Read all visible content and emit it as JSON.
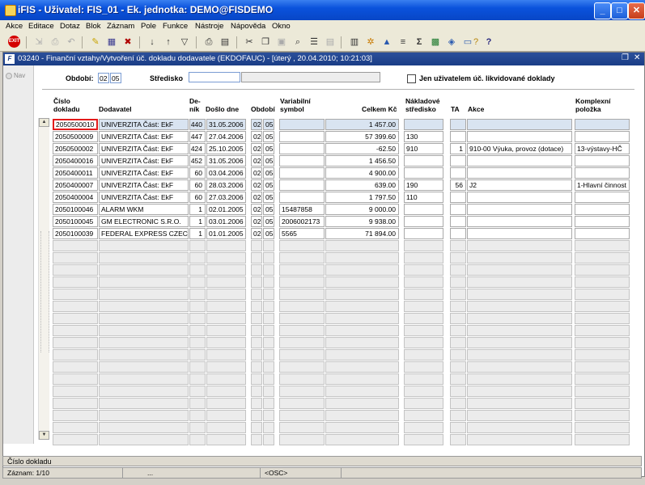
{
  "window": {
    "title": "iFIS - Uživatel: FIS_01 - Ek. jednotka: DEMO@FISDEMO"
  },
  "menu": [
    "Akce",
    "Editace",
    "Dotaz",
    "Blok",
    "Záznam",
    "Pole",
    "Funkce",
    "Nástroje",
    "Nápověda",
    "Okno"
  ],
  "toolbar": {
    "exit_label": "EXIT"
  },
  "form": {
    "title": "03240 - Finanční vztahy/Vytvoření úč. dokladu dodavatele (EKDOFAUC) - [úterý , 20.04.2010; 10:21:03]",
    "nav_label": "Nav",
    "obdobi_label": "Období:",
    "obdobi_1": "02",
    "obdobi_2": "05",
    "stredisko_label": "Středisko",
    "stredisko_value": "",
    "stredisko_desc": "",
    "only_user_label": "Jen uživatelem úč. likvidované doklady"
  },
  "columns": {
    "cislo": [
      "Číslo",
      "dokladu"
    ],
    "dodavatel": "Dodavatel",
    "denik": [
      "De-",
      "ník"
    ],
    "doslo": "Došlo dne",
    "obdobi": "Období",
    "vs": [
      "Variabilní",
      "symbol"
    ],
    "celkem": "Celkem Kč",
    "nakl": [
      "Nákladové",
      "středisko"
    ],
    "ta": "TA",
    "akce": "Akce",
    "komplex": [
      "Komplexní",
      "položka"
    ]
  },
  "rows": [
    {
      "cislo": "2050500010",
      "dodavatel": "UNIVERZITA Část: EkF",
      "denik": "440",
      "doslo": "31.05.2006",
      "o1": "02",
      "o2": "05",
      "vs": "",
      "celkem": "1 457.00",
      "nakl": "",
      "ta": "",
      "akce": "",
      "komplex": ""
    },
    {
      "cislo": "2050500009",
      "dodavatel": "UNIVERZITA Část: EkF",
      "denik": "447",
      "doslo": "27.04.2006",
      "o1": "02",
      "o2": "05",
      "vs": "",
      "celkem": "57 399.60",
      "nakl": "130",
      "ta": "",
      "akce": "",
      "komplex": ""
    },
    {
      "cislo": "2050500002",
      "dodavatel": "UNIVERZITA Část: EkF",
      "denik": "424",
      "doslo": "25.10.2005",
      "o1": "02",
      "o2": "05",
      "vs": "",
      "celkem": "-62.50",
      "nakl": "910",
      "ta": "1",
      "akce": "910-00 Výuka, provoz (dotace)",
      "komplex": "13-výstavy-HČ"
    },
    {
      "cislo": "2050400016",
      "dodavatel": "UNIVERZITA Část: EkF",
      "denik": "452",
      "doslo": "31.05.2006",
      "o1": "02",
      "o2": "05",
      "vs": "",
      "celkem": "1 456.50",
      "nakl": "",
      "ta": "",
      "akce": "",
      "komplex": ""
    },
    {
      "cislo": "2050400011",
      "dodavatel": "UNIVERZITA Část: EkF",
      "denik": "60",
      "doslo": "03.04.2006",
      "o1": "02",
      "o2": "05",
      "vs": "",
      "celkem": "4 900.00",
      "nakl": "",
      "ta": "",
      "akce": "",
      "komplex": ""
    },
    {
      "cislo": "2050400007",
      "dodavatel": "UNIVERZITA Část: EkF",
      "denik": "60",
      "doslo": "28.03.2006",
      "o1": "02",
      "o2": "05",
      "vs": "",
      "celkem": "639.00",
      "nakl": "190",
      "ta": "56",
      "akce": "J2",
      "komplex": "1-Hlavní činnost"
    },
    {
      "cislo": "2050400004",
      "dodavatel": "UNIVERZITA Část: EkF",
      "denik": "60",
      "doslo": "27.03.2006",
      "o1": "02",
      "o2": "05",
      "vs": "",
      "celkem": "1 797.50",
      "nakl": "110",
      "ta": "",
      "akce": "",
      "komplex": ""
    },
    {
      "cislo": "2050100046",
      "dodavatel": "ALARM WKM",
      "denik": "1",
      "doslo": "02.01.2005",
      "o1": "02",
      "o2": "05",
      "vs": "15487858",
      "celkem": "9 000.00",
      "nakl": "",
      "ta": "",
      "akce": "",
      "komplex": ""
    },
    {
      "cislo": "2050100045",
      "dodavatel": "GM ELECTRONIC S.R.O.",
      "denik": "1",
      "doslo": "03.01.2006",
      "o1": "02",
      "o2": "05",
      "vs": "2006002173",
      "celkem": "9 938.00",
      "nakl": "",
      "ta": "",
      "akce": "",
      "komplex": ""
    },
    {
      "cislo": "2050100039",
      "dodavatel": "FEDERAL EXPRESS CZEC",
      "denik": "1",
      "doslo": "01.01.2005",
      "o1": "02",
      "o2": "05",
      "vs": "5565",
      "celkem": "71 894.00",
      "nakl": "",
      "ta": "",
      "akce": "",
      "komplex": ""
    }
  ],
  "status": {
    "line1": "Číslo dokladu",
    "record": "Záznam: 1/10",
    "seg2": "...",
    "mode": "<OSC>"
  },
  "colors": {
    "title_blue": "#0a52dc",
    "form_title": "#1a3d86",
    "selected_row": "#d9e4f1",
    "focus_border": "#e31b1b"
  }
}
